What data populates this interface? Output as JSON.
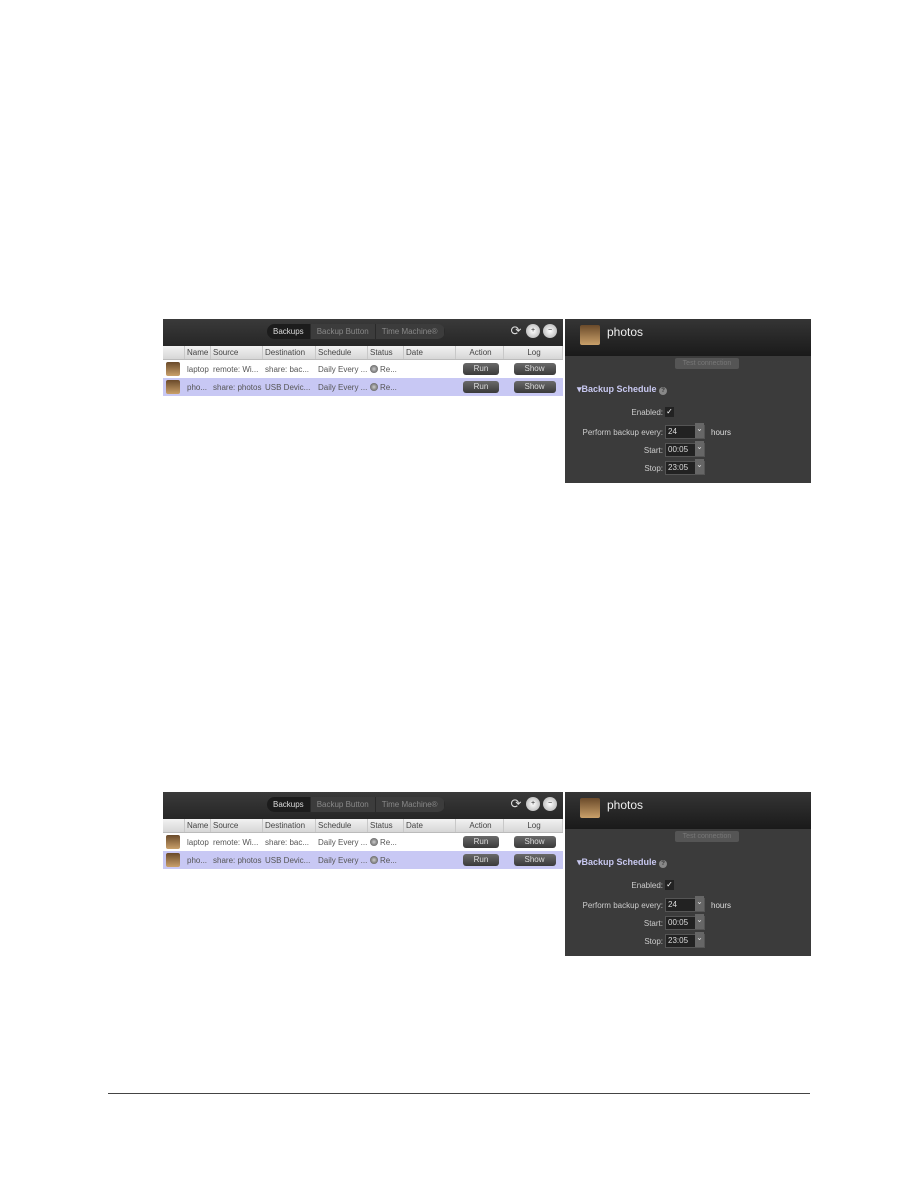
{
  "screens": [
    0,
    1
  ],
  "panel": {
    "tabs": [
      {
        "label": "Backups",
        "active": true
      },
      {
        "label": "Backup Button"
      },
      {
        "label": "Time Machine®"
      }
    ],
    "toolbar_icons": [
      "refresh-icon",
      "add-backup-icon",
      "remove-backup-icon"
    ],
    "columns": [
      "",
      "Name",
      "Source",
      "Destination",
      "Schedule",
      "Status",
      "Date",
      "Action",
      "Log"
    ],
    "rows": [
      {
        "name": "laptop",
        "source": "remote: Wi...",
        "destination": "share: bac...",
        "schedule": "Daily Every ...",
        "status": "Re...",
        "date": "",
        "action": "Run",
        "log": "Show",
        "selected": false
      },
      {
        "name": "pho...",
        "source": "share: photos",
        "destination": "USB Devic...",
        "schedule": "Daily Every ...",
        "status": "Re...",
        "date": "",
        "action": "Run",
        "log": "Show",
        "selected": true
      }
    ],
    "detail": {
      "title": "photos",
      "test_button": "Test connection",
      "section": "Backup Schedule",
      "enabled_label": "Enabled:",
      "enabled": true,
      "every_label": "Perform backup every:",
      "every_value": "24",
      "every_unit": "hours",
      "start_label": "Start:",
      "start_value": "00:05",
      "stop_label": "Stop:",
      "stop_value": "23:05"
    },
    "colors": {
      "selected_row": "#c8c8f4",
      "section_heading": "#c8c8f0"
    }
  }
}
